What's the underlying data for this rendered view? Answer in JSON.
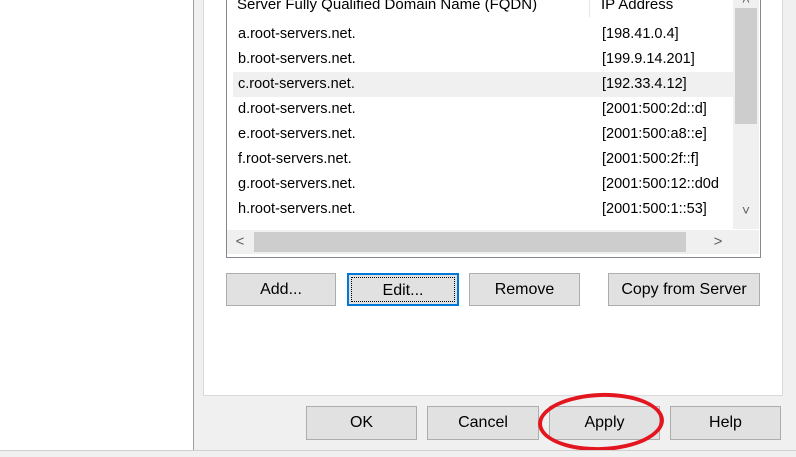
{
  "list": {
    "headers": {
      "fqdn": "Server Fully Qualified Domain Name (FQDN)",
      "ip": "IP Address"
    },
    "rows": [
      {
        "fqdn": "a.root-servers.net.",
        "ip": "[198.41.0.4]"
      },
      {
        "fqdn": "b.root-servers.net.",
        "ip": "[199.9.14.201]"
      },
      {
        "fqdn": "c.root-servers.net.",
        "ip": "[192.33.4.12]"
      },
      {
        "fqdn": "d.root-servers.net.",
        "ip": "[2001:500:2d::d]"
      },
      {
        "fqdn": "e.root-servers.net.",
        "ip": "[2001:500:a8::e]"
      },
      {
        "fqdn": "f.root-servers.net.",
        "ip": "[2001:500:2f::f]"
      },
      {
        "fqdn": "g.root-servers.net.",
        "ip": "[2001:500:12::d0d"
      },
      {
        "fqdn": "h.root-servers.net.",
        "ip": "[2001:500:1::53]"
      }
    ],
    "selected_row": 2
  },
  "list_buttons": {
    "add": "Add...",
    "edit": "Edit...",
    "remove": "Remove",
    "copy": "Copy from Server"
  },
  "dialog_buttons": {
    "ok": "OK",
    "cancel": "Cancel",
    "apply": "Apply",
    "help": "Help"
  },
  "scrollbars": {
    "up": "˄",
    "down": "˅",
    "left": "<",
    "right": ">"
  },
  "annotation": {
    "color": "#e3161f",
    "target": "apply-button"
  }
}
